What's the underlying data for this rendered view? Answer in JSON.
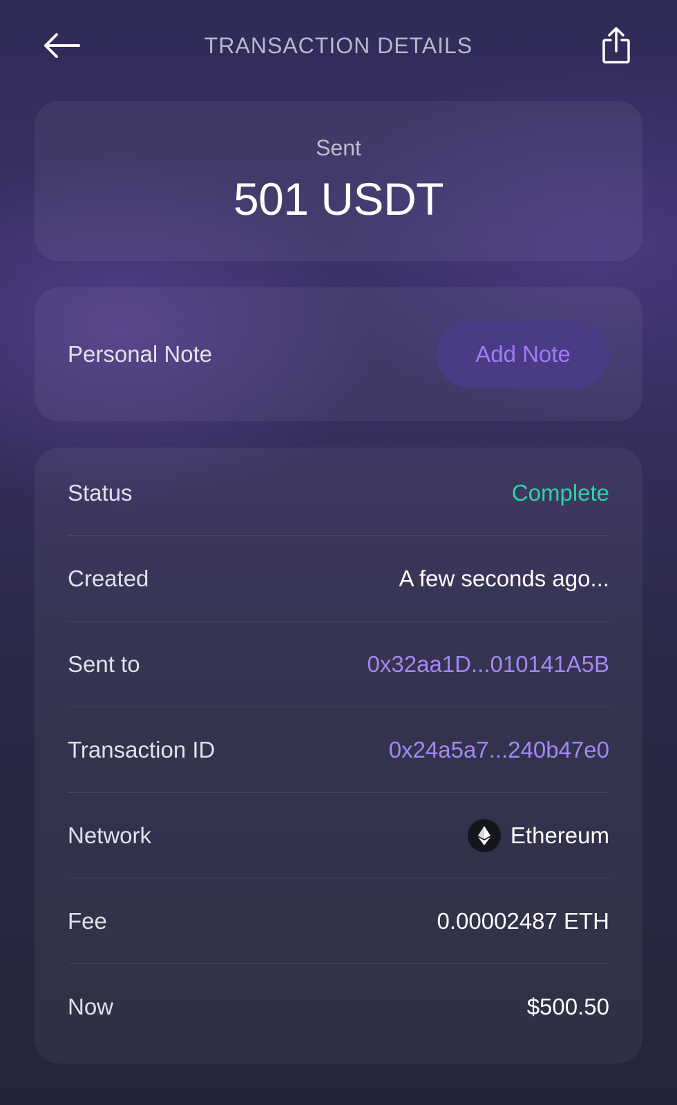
{
  "header": {
    "title": "TRANSACTION DETAILS",
    "back_icon": "arrow-left-icon",
    "share_icon": "share-icon"
  },
  "summary": {
    "label": "Sent",
    "amount": "501 USDT"
  },
  "note": {
    "label": "Personal Note",
    "button_label": "Add Note"
  },
  "details": {
    "rows": [
      {
        "label": "Status",
        "value": "Complete"
      },
      {
        "label": "Created",
        "value": "A few seconds ago..."
      },
      {
        "label": "Sent to",
        "value": "0x32aa1D...010141A5B"
      },
      {
        "label": "Transaction ID",
        "value": "0x24a5a7...240b47e0"
      },
      {
        "label": "Network",
        "value": "Ethereum",
        "icon": "ethereum-icon"
      },
      {
        "label": "Fee",
        "value": "0.00002487 ETH"
      },
      {
        "label": "Now",
        "value": "$500.50"
      }
    ]
  },
  "colors": {
    "status_complete": "#2ed3a3",
    "link": "#a686f2",
    "button_bg": "#4a3b86",
    "button_text": "#a07cf4"
  }
}
